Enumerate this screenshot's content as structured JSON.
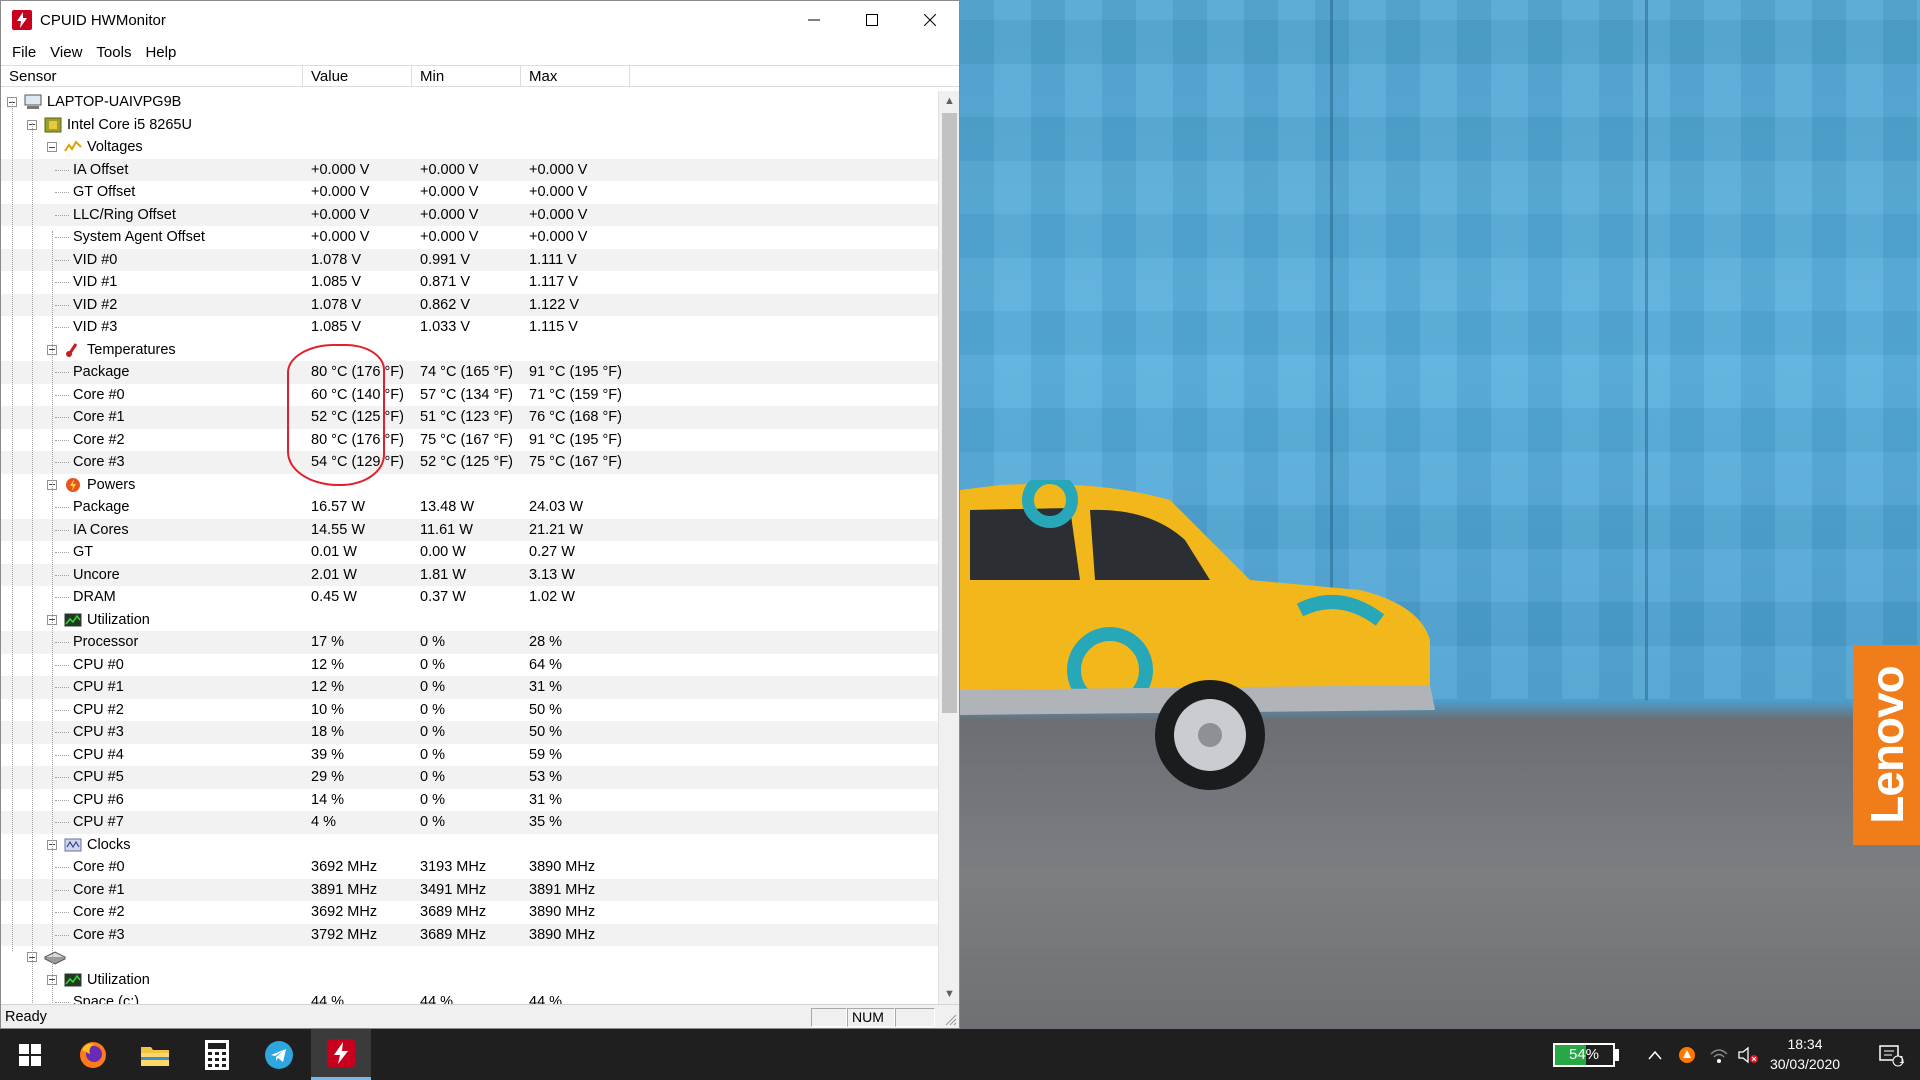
{
  "window": {
    "title": "CPUID HWMonitor",
    "menu": [
      "File",
      "View",
      "Tools",
      "Help"
    ],
    "columns": [
      "Sensor",
      "Value",
      "Min",
      "Max"
    ],
    "rows": [
      {
        "label": "LAPTOP-UAIVPG9B",
        "depth": 0,
        "kind": "node",
        "icon": "computer-icon",
        "value": "",
        "min": "",
        "max": ""
      },
      {
        "label": "Intel Core i5 8265U",
        "depth": 1,
        "kind": "node",
        "icon": "cpu-icon",
        "value": "",
        "min": "",
        "max": ""
      },
      {
        "label": "Voltages",
        "depth": 2,
        "kind": "node",
        "icon": "voltage-icon",
        "value": "",
        "min": "",
        "max": ""
      },
      {
        "label": "IA Offset",
        "depth": 3,
        "kind": "leaf",
        "value": "+0.000 V",
        "min": "+0.000 V",
        "max": "+0.000 V"
      },
      {
        "label": "GT Offset",
        "depth": 3,
        "kind": "leaf",
        "value": "+0.000 V",
        "min": "+0.000 V",
        "max": "+0.000 V"
      },
      {
        "label": "LLC/Ring Offset",
        "depth": 3,
        "kind": "leaf",
        "value": "+0.000 V",
        "min": "+0.000 V",
        "max": "+0.000 V"
      },
      {
        "label": "System Agent Offset",
        "depth": 3,
        "kind": "leaf",
        "value": "+0.000 V",
        "min": "+0.000 V",
        "max": "+0.000 V"
      },
      {
        "label": "VID #0",
        "depth": 3,
        "kind": "leaf",
        "value": "1.078 V",
        "min": "0.991 V",
        "max": "1.111 V"
      },
      {
        "label": "VID #1",
        "depth": 3,
        "kind": "leaf",
        "value": "1.085 V",
        "min": "0.871 V",
        "max": "1.117 V"
      },
      {
        "label": "VID #2",
        "depth": 3,
        "kind": "leaf",
        "value": "1.078 V",
        "min": "0.862 V",
        "max": "1.122 V"
      },
      {
        "label": "VID #3",
        "depth": 3,
        "kind": "leaf",
        "value": "1.085 V",
        "min": "1.033 V",
        "max": "1.115 V"
      },
      {
        "label": "Temperatures",
        "depth": 2,
        "kind": "node",
        "icon": "thermometer-icon",
        "value": "",
        "min": "",
        "max": ""
      },
      {
        "label": "Package",
        "depth": 3,
        "kind": "leaf",
        "value": "80 °C  (176 °F)",
        "min": "74 °C  (165 °F)",
        "max": "91 °C  (195 °F)"
      },
      {
        "label": "Core #0",
        "depth": 3,
        "kind": "leaf",
        "value": "60 °C  (140 °F)",
        "min": "57 °C  (134 °F)",
        "max": "71 °C  (159 °F)"
      },
      {
        "label": "Core #1",
        "depth": 3,
        "kind": "leaf",
        "value": "52 °C  (125 °F)",
        "min": "51 °C  (123 °F)",
        "max": "76 °C  (168 °F)"
      },
      {
        "label": "Core #2",
        "depth": 3,
        "kind": "leaf",
        "value": "80 °C  (176 °F)",
        "min": "75 °C  (167 °F)",
        "max": "91 °C  (195 °F)"
      },
      {
        "label": "Core #3",
        "depth": 3,
        "kind": "leaf",
        "value": "54 °C  (129 °F)",
        "min": "52 °C  (125 °F)",
        "max": "75 °C  (167 °F)"
      },
      {
        "label": "Powers",
        "depth": 2,
        "kind": "node",
        "icon": "power-icon",
        "value": "",
        "min": "",
        "max": ""
      },
      {
        "label": "Package",
        "depth": 3,
        "kind": "leaf",
        "value": "16.57 W",
        "min": "13.48 W",
        "max": "24.03 W"
      },
      {
        "label": "IA Cores",
        "depth": 3,
        "kind": "leaf",
        "value": "14.55 W",
        "min": "11.61 W",
        "max": "21.21 W"
      },
      {
        "label": "GT",
        "depth": 3,
        "kind": "leaf",
        "value": "0.01 W",
        "min": "0.00 W",
        "max": "0.27 W"
      },
      {
        "label": "Uncore",
        "depth": 3,
        "kind": "leaf",
        "value": "2.01 W",
        "min": "1.81 W",
        "max": "3.13 W"
      },
      {
        "label": "DRAM",
        "depth": 3,
        "kind": "leaf",
        "value": "0.45 W",
        "min": "0.37 W",
        "max": "1.02 W"
      },
      {
        "label": "Utilization",
        "depth": 2,
        "kind": "node",
        "icon": "utilization-icon",
        "value": "",
        "min": "",
        "max": ""
      },
      {
        "label": "Processor",
        "depth": 3,
        "kind": "leaf",
        "value": "17 %",
        "min": "0 %",
        "max": "28 %"
      },
      {
        "label": "CPU #0",
        "depth": 3,
        "kind": "leaf",
        "value": "12 %",
        "min": "0 %",
        "max": "64 %"
      },
      {
        "label": "CPU #1",
        "depth": 3,
        "kind": "leaf",
        "value": "12 %",
        "min": "0 %",
        "max": "31 %"
      },
      {
        "label": "CPU #2",
        "depth": 3,
        "kind": "leaf",
        "value": "10 %",
        "min": "0 %",
        "max": "50 %"
      },
      {
        "label": "CPU #3",
        "depth": 3,
        "kind": "leaf",
        "value": "18 %",
        "min": "0 %",
        "max": "50 %"
      },
      {
        "label": "CPU #4",
        "depth": 3,
        "kind": "leaf",
        "value": "39 %",
        "min": "0 %",
        "max": "59 %"
      },
      {
        "label": "CPU #5",
        "depth": 3,
        "kind": "leaf",
        "value": "29 %",
        "min": "0 %",
        "max": "53 %"
      },
      {
        "label": "CPU #6",
        "depth": 3,
        "kind": "leaf",
        "value": "14 %",
        "min": "0 %",
        "max": "31 %"
      },
      {
        "label": "CPU #7",
        "depth": 3,
        "kind": "leaf",
        "value": "4 %",
        "min": "0 %",
        "max": "35 %"
      },
      {
        "label": "Clocks",
        "depth": 2,
        "kind": "node",
        "icon": "clock-icon",
        "value": "",
        "min": "",
        "max": ""
      },
      {
        "label": "Core #0",
        "depth": 3,
        "kind": "leaf",
        "value": "3692 MHz",
        "min": "3193 MHz",
        "max": "3890 MHz"
      },
      {
        "label": "Core #1",
        "depth": 3,
        "kind": "leaf",
        "value": "3891 MHz",
        "min": "3491 MHz",
        "max": "3891 MHz"
      },
      {
        "label": "Core #2",
        "depth": 3,
        "kind": "leaf",
        "value": "3692 MHz",
        "min": "3689 MHz",
        "max": "3890 MHz"
      },
      {
        "label": "Core #3",
        "depth": 3,
        "kind": "leaf",
        "value": "3792 MHz",
        "min": "3689 MHz",
        "max": "3890 MHz"
      },
      {
        "label": "",
        "depth": 1,
        "kind": "node",
        "icon": "disk-icon",
        "value": "",
        "min": "",
        "max": ""
      },
      {
        "label": "Utilization",
        "depth": 2,
        "kind": "node",
        "icon": "utilization-icon",
        "value": "",
        "min": "",
        "max": ""
      },
      {
        "label": "Space (c:)",
        "depth": 3,
        "kind": "leaf",
        "value": "44 %",
        "min": "44 %",
        "max": "44 %"
      }
    ],
    "status": "Ready",
    "status_panes": [
      "",
      "NUM",
      ""
    ]
  },
  "desktop": {
    "brand": "Lenovo",
    "accent_color": "#f07c1a"
  },
  "taskbar": {
    "apps": [
      {
        "name": "firefox",
        "active": false
      },
      {
        "name": "file-explorer",
        "active": false
      },
      {
        "name": "calculator",
        "active": false
      },
      {
        "name": "telegram",
        "active": false
      },
      {
        "name": "hwmonitor",
        "active": true
      }
    ],
    "battery_percent": 54,
    "battery_label": "54%",
    "time": "18:34",
    "date": "30/03/2020",
    "notification_count": "1"
  }
}
